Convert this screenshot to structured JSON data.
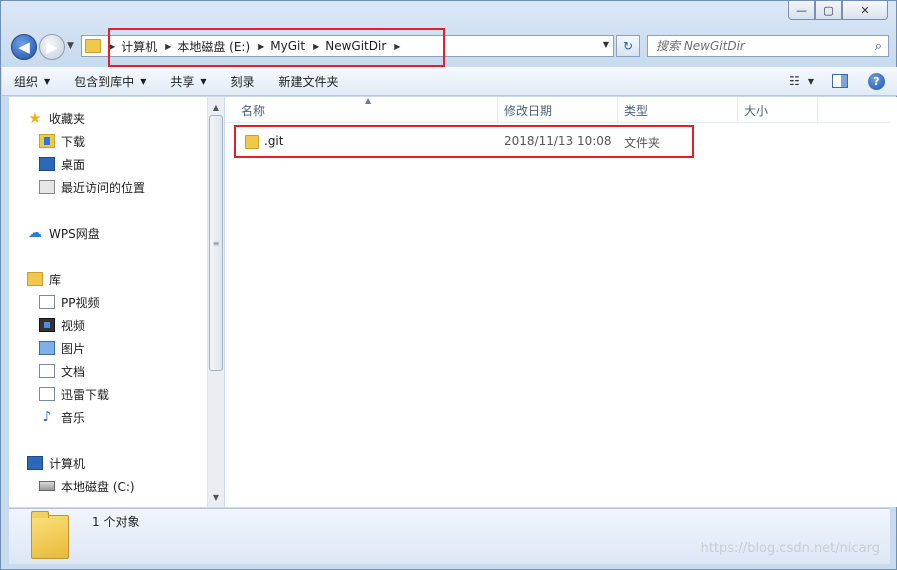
{
  "window": {
    "minimize_glyph": "—",
    "maximize_glyph": "▢",
    "close_glyph": "✕"
  },
  "navigation": {
    "back_glyph": "◀",
    "forward_glyph": "▶",
    "breadcrumbs": [
      "计算机",
      "本地磁盘 (E:)",
      "MyGit",
      "NewGitDir"
    ],
    "refresh_glyph": "↻"
  },
  "search": {
    "placeholder": "搜索 NewGitDir"
  },
  "toolbar": {
    "items": [
      {
        "label": "组织",
        "dropdown": true
      },
      {
        "label": "包含到库中",
        "dropdown": true
      },
      {
        "label": "共享",
        "dropdown": true
      },
      {
        "label": "刻录",
        "dropdown": false
      },
      {
        "label": "新建文件夹",
        "dropdown": false
      }
    ],
    "help_glyph": "?"
  },
  "sidebar": {
    "favorites": {
      "label": "收藏夹",
      "icon": "star-icon"
    },
    "favorite_items": [
      {
        "label": "下载",
        "icon": "downloads-folder-icon"
      },
      {
        "label": "桌面",
        "icon": "desktop-icon"
      },
      {
        "label": "最近访问的位置",
        "icon": "recent-places-icon"
      }
    ],
    "cloud": {
      "label": "WPS网盘",
      "icon": "cloud-icon"
    },
    "libraries": {
      "label": "库",
      "icon": "library-icon"
    },
    "library_items": [
      {
        "label": "PP视频",
        "icon": "document-icon"
      },
      {
        "label": "视频",
        "icon": "video-icon"
      },
      {
        "label": "图片",
        "icon": "pictures-icon"
      },
      {
        "label": "文档",
        "icon": "document-icon"
      },
      {
        "label": "迅雷下载",
        "icon": "document-icon"
      },
      {
        "label": "音乐",
        "icon": "music-icon"
      }
    ],
    "computer": {
      "label": "计算机",
      "icon": "computer-icon"
    },
    "computer_items": [
      {
        "label": "本地磁盘 (C:)",
        "icon": "drive-icon"
      }
    ]
  },
  "columns": [
    "名称",
    "修改日期",
    "类型",
    "大小"
  ],
  "files": [
    {
      "name": ".git",
      "modified": "2018/11/13 10:08",
      "type": "文件夹",
      "size": ""
    }
  ],
  "status": {
    "count_text": "1 个对象"
  },
  "watermark": "https://blog.csdn.net/nicarg",
  "colors": {
    "highlight_border": "#e0212b",
    "folder": "#f0c94a",
    "accent_blue": "#1c4fa8"
  }
}
